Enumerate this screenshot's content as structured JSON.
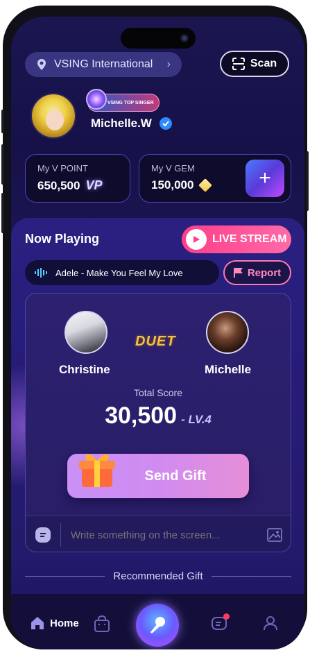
{
  "header": {
    "region": "VSING International",
    "scan_label": "Scan"
  },
  "profile": {
    "badge_text": "VSING TOP SINGER",
    "username": "Michelle.W"
  },
  "wallet": {
    "points_label": "My V POINT",
    "points_value": "650,500",
    "points_unit": "VP",
    "gems_label": "My V GEM",
    "gems_value": "150,000"
  },
  "now_playing": {
    "title": "Now Playing",
    "live_label": "LIVE STREAM",
    "song": "Adele - Make You Feel My Love",
    "report_label": "Report"
  },
  "duet": {
    "mode_label": "DUET",
    "singer_left": "Christine",
    "singer_right": "Michelle",
    "score_label": "Total Score",
    "score_value": "30,500",
    "level": "- LV.4",
    "gift_label": "Send Gift",
    "chat_placeholder": "Write something on the screen..."
  },
  "recommended": {
    "title": "Recommended Gift"
  },
  "nav": {
    "home_label": "Home"
  },
  "colors": {
    "accent_pink": "#ff3d8a",
    "panel_purple": "#2a2080",
    "gift_gradient": "#c990f5"
  }
}
